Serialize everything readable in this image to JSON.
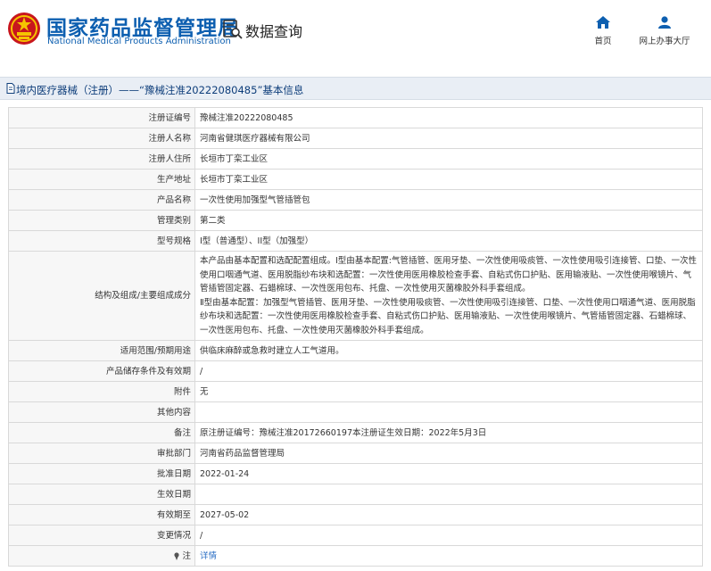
{
  "header": {
    "site_name_cn": "国家药品监督管理局",
    "site_name_en": "National Medical Products Administration",
    "query_title": "数据查询",
    "nav": {
      "home": "首页",
      "office": "网上办事大厅"
    }
  },
  "title_bar": {
    "text": "境内医疗器械（注册）——“豫械注准20222080485”基本信息"
  },
  "rows": [
    {
      "label": "注册证编号",
      "value": "豫械注准20222080485"
    },
    {
      "label": "注册人名称",
      "value": "河南省健琪医疗器械有限公司"
    },
    {
      "label": "注册人住所",
      "value": "长垣市丁栾工业区"
    },
    {
      "label": "生产地址",
      "value": "长垣市丁栾工业区"
    },
    {
      "label": "产品名称",
      "value": "一次性使用加强型气管插管包"
    },
    {
      "label": "管理类别",
      "value": "第二类"
    },
    {
      "label": "型号规格",
      "value": "I型（普通型）、II型（加强型）"
    },
    {
      "label": "结构及组成/主要组成成分",
      "value": "本产品由基本配置和选配配置组成。Ⅰ型由基本配置:气管插管、医用牙垫、一次性使用吸痰管、一次性使用吸引连接管、口垫、一次性使用口咽通气道、医用脱脂纱布块和选配置：一次性使用医用橡胶检查手套、自粘式伤口护贴、医用输液贴、一次性使用喉镜片、气管插管固定器、石蜡棉球、一次性医用包布、托盘、一次性使用灭菌橡胶外科手套组成。\nⅡ型由基本配置：加强型气管插管、医用牙垫、一次性使用吸痰管、一次性使用吸引连接管、口垫、一次性使用口咽通气道、医用脱脂纱布块和选配置：一次性使用医用橡胶检查手套、自粘式伤口护贴、医用输液贴、一次性使用喉镜片、气管插管固定器、石蜡棉球、一次性医用包布、托盘、一次性使用灭菌橡胶外科手套组成。"
    },
    {
      "label": "适用范围/预期用途",
      "value": "供临床麻醉或急救时建立人工气道用。"
    },
    {
      "label": "产品储存条件及有效期",
      "value": "/"
    },
    {
      "label": "附件",
      "value": "无"
    },
    {
      "label": "其他内容",
      "value": ""
    },
    {
      "label": "备注",
      "value": "原注册证编号：豫械注准20172660197本注册证生效日期：2022年5月3日"
    },
    {
      "label": "审批部门",
      "value": "河南省药品监督管理局"
    },
    {
      "label": "批准日期",
      "value": "2022-01-24"
    },
    {
      "label": "生效日期",
      "value": ""
    },
    {
      "label": "有效期至",
      "value": "2027-05-02"
    },
    {
      "label": "变更情况",
      "value": "/"
    },
    {
      "label": "注",
      "value": "详情"
    }
  ],
  "colors": {
    "brand_blue": "#0d5fb0",
    "title_bar_bg": "#e9eef5",
    "link": "#2b6fc4"
  }
}
